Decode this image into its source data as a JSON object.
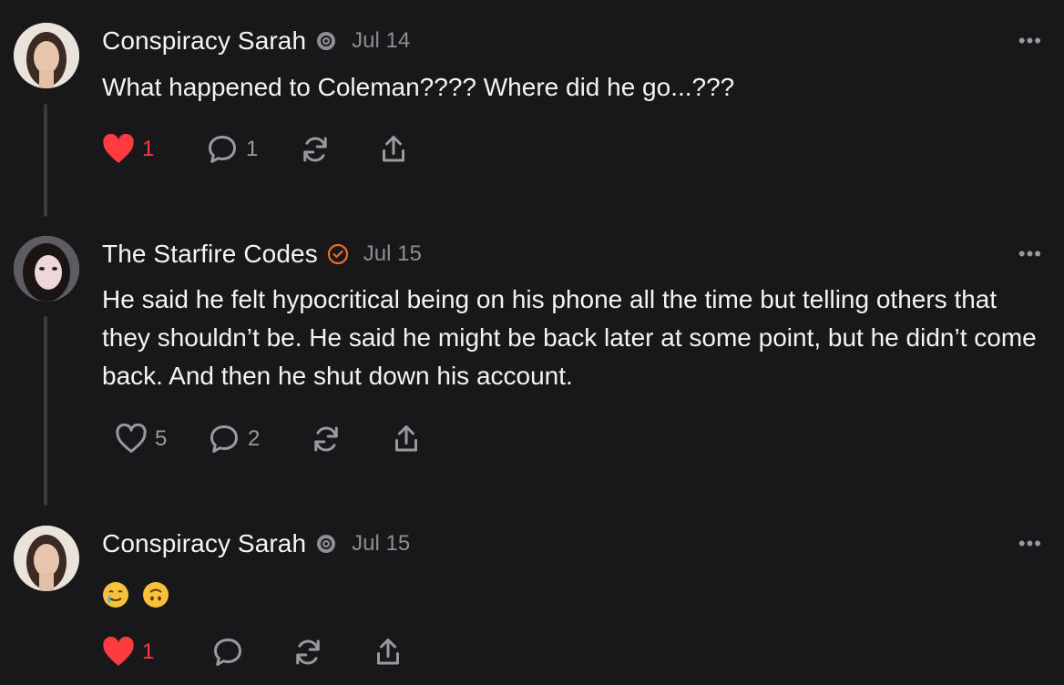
{
  "posts": [
    {
      "author": "Conspiracy Sarah",
      "date": "Jul 14",
      "text": "What happened to Coleman???? Where did he go...???",
      "likes": "1",
      "comments": "1",
      "liked": true
    },
    {
      "author": "The Starfire Codes",
      "date": "Jul 15",
      "text": "He said he felt hypocritical being on his phone all the time but telling others that they shouldn’t be. He said he might be back later at some point, but he didn’t come back. And then he shut down his account.",
      "likes": "5",
      "comments": "2",
      "liked": false
    },
    {
      "author": "Conspiracy Sarah",
      "date": "Jul 15",
      "text": "",
      "emojis": [
        "crying-smile-emoji",
        "upside-down-face-emoji"
      ],
      "likes": "1",
      "comments": "",
      "liked": true
    }
  ],
  "more_label": "•••",
  "colors": {
    "background": "#18181a",
    "liked": "#ff3b40",
    "muted": "#9a9a9e",
    "verified_orange": "#f26a24"
  },
  "icons": [
    "heart-icon",
    "comment-icon",
    "repost-icon",
    "share-icon",
    "more-icon",
    "settings-badge-icon",
    "verified-badge-icon"
  ]
}
